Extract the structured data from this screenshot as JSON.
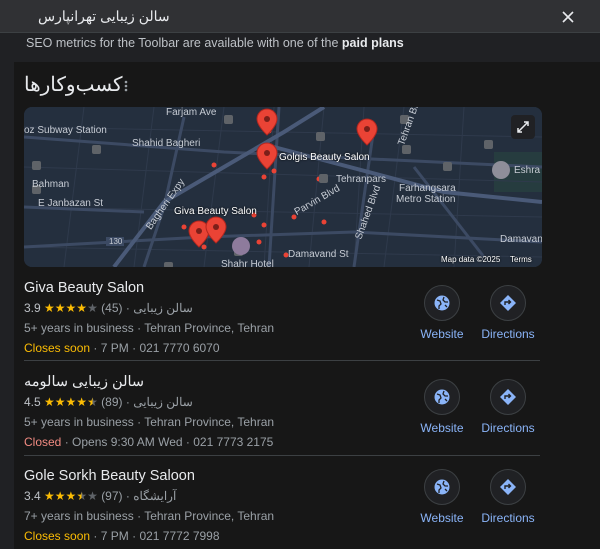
{
  "search": {
    "query": "سالن زیبایی تهرانپارس"
  },
  "seo_banner": {
    "prefix": "SEO metrics for the Toolbar are available with one of the",
    "link": "paid plans"
  },
  "section": {
    "title": "کسب‌وکارها"
  },
  "map": {
    "labels": {
      "farjam": "Farjam Ave",
      "subway": "oz Subway Station",
      "shahid_bagheri": "Shahid Bagheri",
      "golgis": "Golgis Beauty Salon",
      "tehranpars": "Tehranpars",
      "farhangsara": "Farhangsara",
      "metro_station": "Metro Station",
      "eshrat": "Eshra",
      "bahman": "Bahman",
      "janbazan": "E Janbazan St",
      "bagheri_expy": "Bagheri Expy",
      "giva": "Giva Beauty Salon",
      "parvin": "Parvin Blvd",
      "shahed": "Shahed Blvd",
      "damavand1": "Damavand",
      "damavand2": "Damavand St",
      "tehran_blvd": "Tehran Blvd",
      "shahr_hotel": "Shahr Hotel",
      "route": "130"
    },
    "map_data": "Map data ©2025",
    "terms": "Terms"
  },
  "listings": [
    {
      "name": "Giva Beauty Salon",
      "rating": "3.9",
      "reviews": "(45)",
      "category": "سالن زیبایی",
      "years": "5+ years in business",
      "location": "Tehran Province, Tehran",
      "status": "Closes soon",
      "status_type": "closes-soon",
      "hours": "7 PM",
      "phone": "021 7770 6070",
      "stars_filled": 4,
      "stars_half": 0
    },
    {
      "name": "سالن زیبایی سالومه",
      "rating": "4.5",
      "reviews": "(89)",
      "category": "سالن زیبایی",
      "years": "5+ years in business",
      "location": "Tehran Province, Tehran",
      "status": "Closed",
      "status_type": "closed",
      "hours": "Opens 9:30 AM Wed",
      "phone": "021 7773 2175",
      "stars_filled": 4,
      "stars_half": 1
    },
    {
      "name": "Gole Sorkh Beauty Saloon",
      "rating": "3.4",
      "reviews": "(97)",
      "category": "آرایشگاه",
      "years": "7+ years in business",
      "location": "Tehran Province, Tehran",
      "status": "Closes soon",
      "status_type": "closes-soon",
      "hours": "7 PM",
      "phone": "021 7772 7998",
      "stars_filled": 3,
      "stars_half": 1
    }
  ],
  "actions": {
    "website": "Website",
    "directions": "Directions"
  },
  "separators": {
    "dot": "·"
  },
  "colors": {
    "accent_link": "#8ab4f8",
    "star": "#fbbc04",
    "closed": "#f28b82",
    "pin": "#ea4335"
  }
}
